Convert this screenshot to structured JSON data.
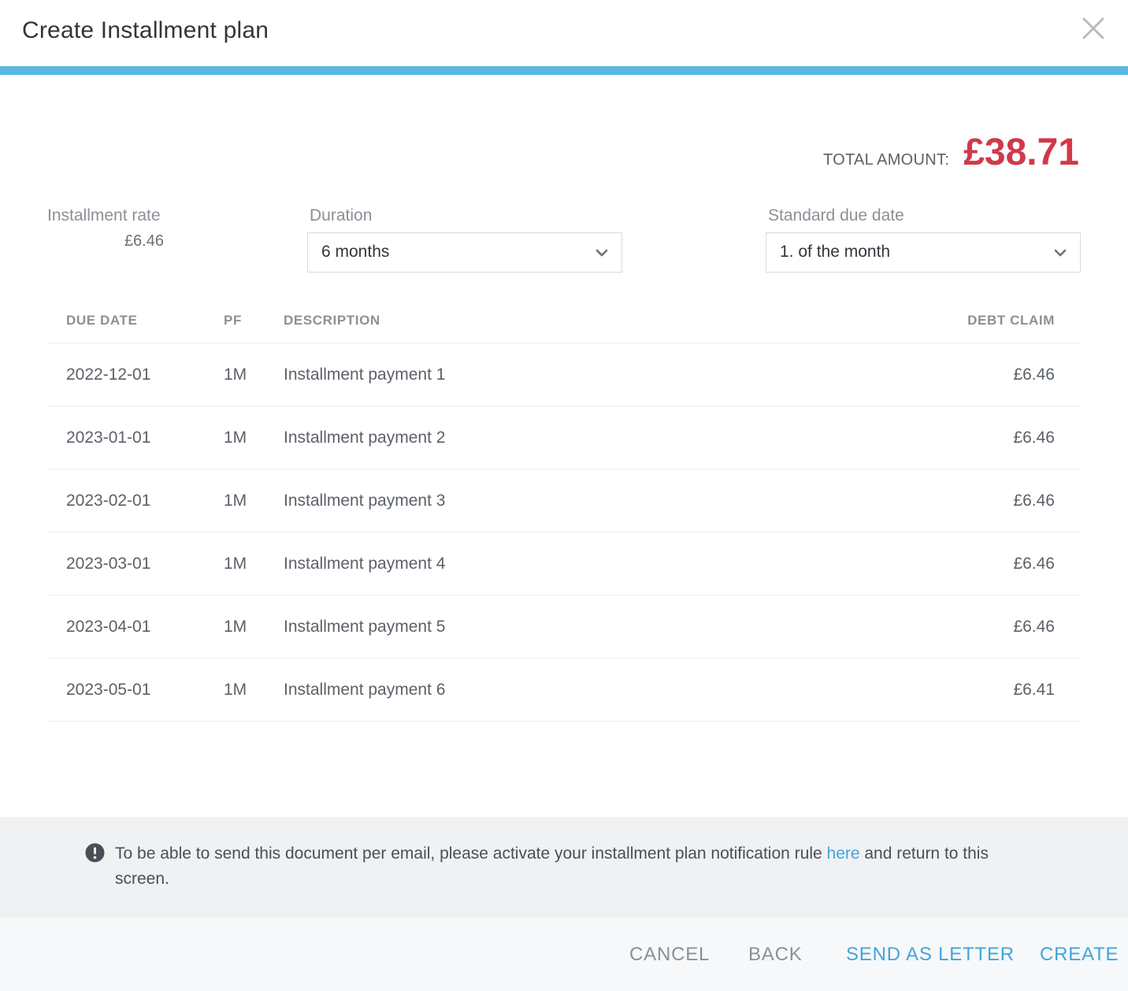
{
  "dialog": {
    "title": "Create Installment plan",
    "accent_color": "#5ab7e0"
  },
  "summary": {
    "total_label": "TOTAL AMOUNT:",
    "total_value": "£38.71",
    "total_color": "#d0394a"
  },
  "rate": {
    "label": "Installment rate",
    "value": "£6.46"
  },
  "duration": {
    "label": "Duration",
    "selected": "6 months"
  },
  "due_date": {
    "label": "Standard due date",
    "selected": "1. of the month"
  },
  "table": {
    "headers": {
      "due_date": "DUE DATE",
      "pf": "PF",
      "description": "DESCRIPTION",
      "debt_claim": "DEBT CLAIM"
    },
    "rows": [
      {
        "due_date": "2022-12-01",
        "pf": "1M",
        "description": "Installment payment 1",
        "debt_claim": "£6.46"
      },
      {
        "due_date": "2023-01-01",
        "pf": "1M",
        "description": "Installment payment 2",
        "debt_claim": "£6.46"
      },
      {
        "due_date": "2023-02-01",
        "pf": "1M",
        "description": "Installment payment 3",
        "debt_claim": "£6.46"
      },
      {
        "due_date": "2023-03-01",
        "pf": "1M",
        "description": "Installment payment 4",
        "debt_claim": "£6.46"
      },
      {
        "due_date": "2023-04-01",
        "pf": "1M",
        "description": "Installment payment 5",
        "debt_claim": "£6.46"
      },
      {
        "due_date": "2023-05-01",
        "pf": "1M",
        "description": "Installment payment 6",
        "debt_claim": "£6.41"
      }
    ]
  },
  "notice": {
    "icon": "exclamation-circle-icon",
    "text_before": "To be able to send this document per email, please activate your installment plan notification rule ",
    "link_text": "here",
    "text_after": " and return to this screen."
  },
  "footer": {
    "cancel_label": "CANCEL",
    "back_label": "BACK",
    "send_letter_label": "SEND AS LETTER",
    "create_label": "CREATE",
    "link_color": "#3ea6dc"
  }
}
